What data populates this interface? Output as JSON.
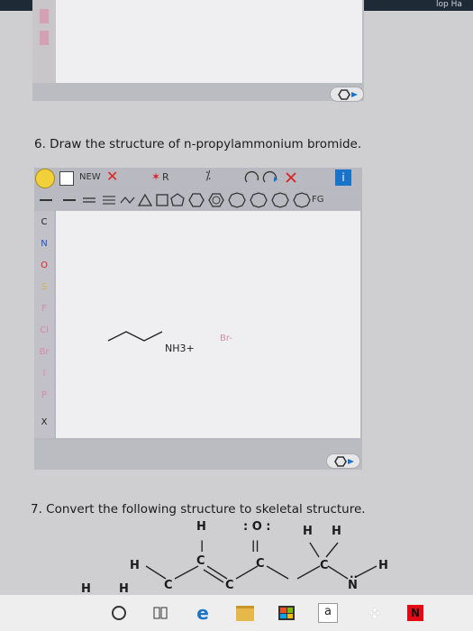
{
  "top_strip": {
    "left_text": "...",
    "right_text": "lop Ha"
  },
  "question6": {
    "title": "6. Draw the structure of n-propylammonium bromide.",
    "toolbar": {
      "new_label": "NEW",
      "r_label": "R",
      "fg_label": "FG",
      "info_label": "i"
    },
    "element_buttons": [
      "C",
      "N",
      "O",
      "S",
      "F",
      "Cl",
      "Br",
      "I",
      "P",
      "X"
    ],
    "canvas": {
      "cation_label": "NH3+",
      "anion_label": "Br-"
    }
  },
  "question7": {
    "title": "7. Convert the following structure to skeletal structure.",
    "atoms": [
      "H",
      ": O :",
      "H",
      "H",
      "H",
      "C",
      "C",
      "C",
      "C",
      "C",
      "N",
      "H",
      "H",
      "H",
      "||",
      "|",
      "..",
      "H"
    ]
  },
  "taskbar": {
    "items": [
      "circle-icon",
      "task-view-icon",
      "edge-icon",
      "file-explorer-icon",
      "store-icon",
      "amazon-icon",
      "dropbox-icon",
      "netflix-icon"
    ],
    "amazon_label": "a",
    "netflix_label": "N"
  },
  "colors": {
    "accent_blue": "#1a73c8",
    "x_red": "#d22",
    "yellow": "#f2d03b"
  }
}
